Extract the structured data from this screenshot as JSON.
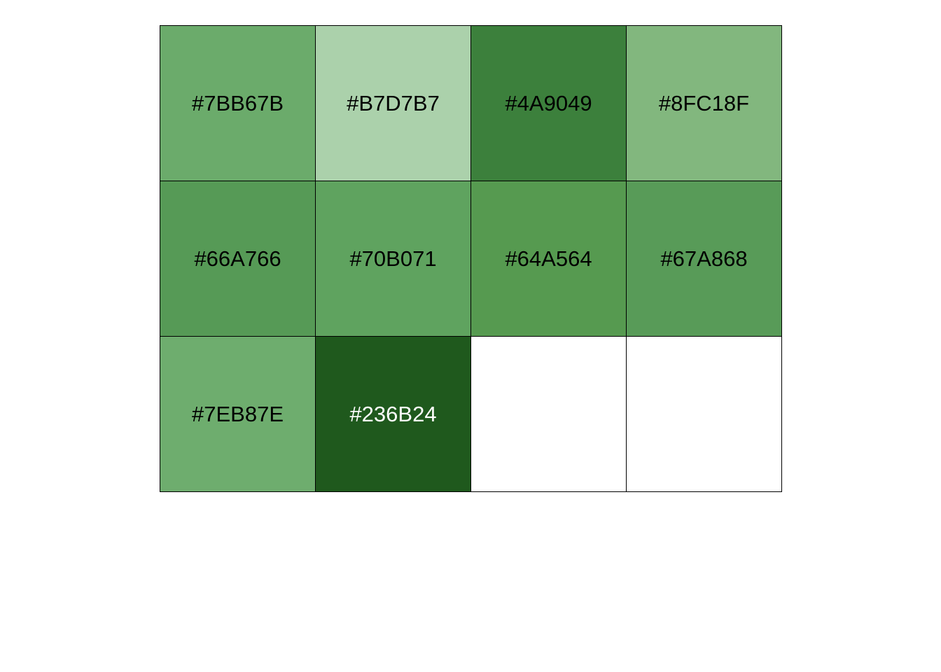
{
  "swatches": [
    {
      "label": "#7BB67B",
      "fill": "#6BAB6B",
      "text_color": "#000000"
    },
    {
      "label": "#B7D7B7",
      "fill": "#ABD1AB",
      "text_color": "#000000"
    },
    {
      "label": "#4A9049",
      "fill": "#3C803C",
      "text_color": "#000000"
    },
    {
      "label": "#8FC18F",
      "fill": "#82B77E",
      "text_color": "#000000"
    },
    {
      "label": "#66A766",
      "fill": "#569A56",
      "text_color": "#000000"
    },
    {
      "label": "#70B071",
      "fill": "#5FA35F",
      "text_color": "#000000"
    },
    {
      "label": "#64A564",
      "fill": "#569A50",
      "text_color": "#000000"
    },
    {
      "label": "#67A868",
      "fill": "#589B58",
      "text_color": "#000000"
    },
    {
      "label": "#7EB87E",
      "fill": "#6EAD6E",
      "text_color": "#000000"
    },
    {
      "label": "#236B24",
      "fill": "#1F591D",
      "text_color": "#FFFFFF"
    },
    {
      "label": "",
      "fill": "#FFFFFF",
      "text_color": "#000000"
    },
    {
      "label": "",
      "fill": "#FFFFFF",
      "text_color": "#000000"
    }
  ]
}
